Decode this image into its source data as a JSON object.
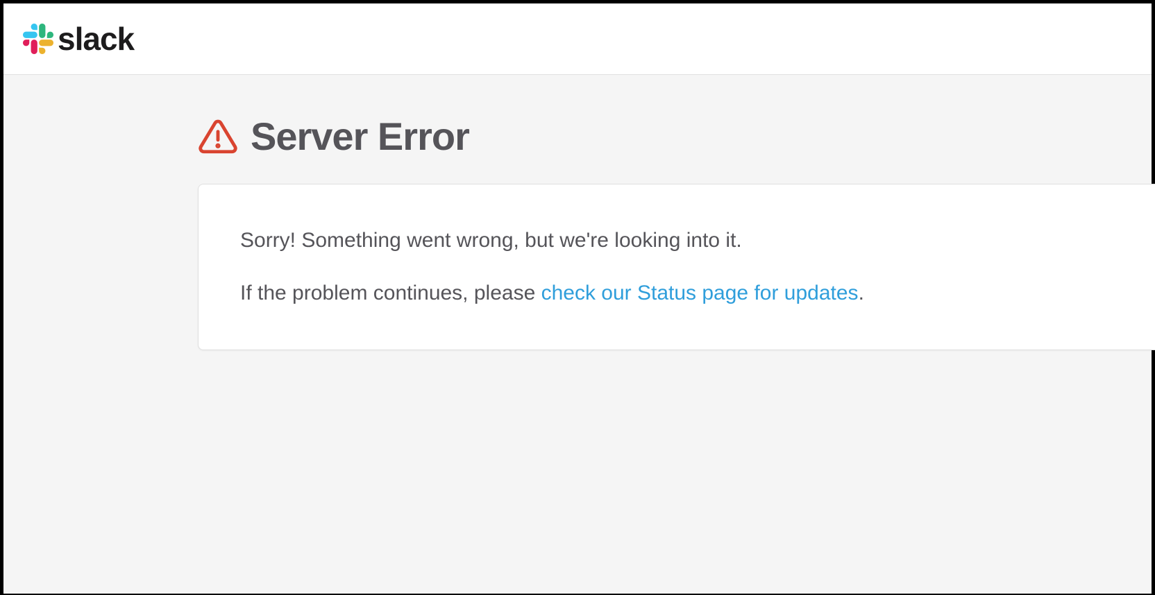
{
  "header": {
    "brand_name": "slack"
  },
  "error": {
    "title": "Server Error",
    "message_line1": "Sorry! Something went wrong, but we're looking into it.",
    "message_line2_prefix": "If the problem continues, please ",
    "status_link_text": "check our Status page for updates",
    "message_line2_suffix": "."
  }
}
